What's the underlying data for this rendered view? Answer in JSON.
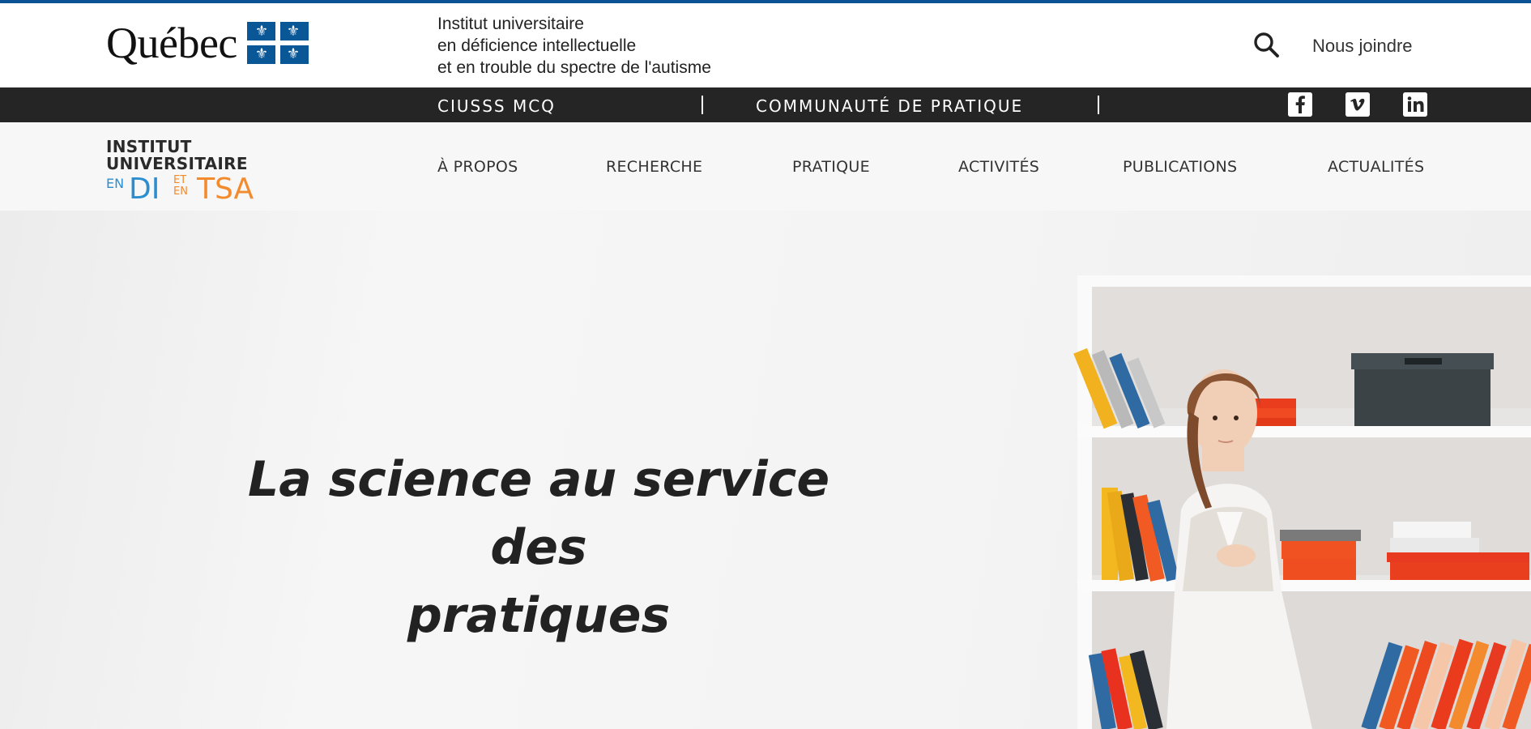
{
  "header": {
    "quebec_logo_text": "Québec",
    "institute_title_lines": [
      "Institut universitaire",
      "en déficience intellectuelle",
      "et en trouble du spectre de l'autisme"
    ],
    "contact_label": "Nous joindre"
  },
  "topbar": {
    "links": [
      "CIUSSS MCQ",
      "COMMUNAUTÉ DE PRATIQUE"
    ],
    "social": [
      "facebook-icon",
      "vimeo-icon",
      "linkedin-icon"
    ]
  },
  "brand": {
    "line1": "INSTITUT",
    "line2": "UNIVERSITAIRE",
    "en1": "EN",
    "di": "DI",
    "et": "ET",
    "en2": "EN",
    "tsa": "TSA"
  },
  "nav": {
    "items": [
      "À PROPOS",
      "RECHERCHE",
      "PRATIQUE",
      "ACTIVITÉS",
      "PUBLICATIONS",
      "ACTUALITÉS"
    ]
  },
  "hero": {
    "title_line1": "La science au service des",
    "title_line2": "pratiques"
  },
  "colors": {
    "top_accent": "#0b5394",
    "black_bar": "#252525",
    "brand_blue": "#2d8ecf",
    "brand_orange": "#f28a2e"
  }
}
